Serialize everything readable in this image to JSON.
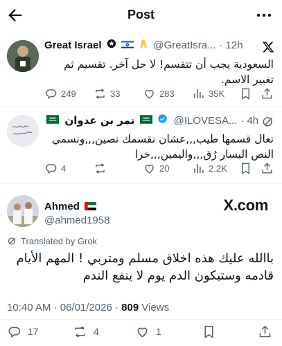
{
  "header": {
    "title": "Post"
  },
  "quote1": {
    "name": "Great Israel",
    "handle": "@GreatIsra...",
    "time": "12h",
    "text": "السعودية يجب أن تتقسم! لا حل آخر. تقسيم ثم تغيير الاسم.",
    "replies": "249",
    "reposts": "33",
    "likes": "283",
    "views": "35K",
    "flag_colors": [
      "#ffffff",
      "#0038b8"
    ],
    "ribbon_color": "#f5c842"
  },
  "quote2": {
    "name": "نمر بن عدوان",
    "handle": "@ILOVESA...",
    "time": "4h",
    "text": "تعال قسمها طيب,,,عشان نقسمك نصين,,,ونسمي النص اليسار رُق,,,واليمين,,,خرا",
    "replies": "4",
    "likes": "20",
    "views": "2.2K",
    "flag_color": "#006c35"
  },
  "main": {
    "name": "Ahmed",
    "handle": "@ahmed1958",
    "brand": "X.com",
    "translated": "Translated by Grok",
    "text": "باالله عليك هذه اخلاق مسلم ومتربي ! المهم الأيام قادمه وستبكون الدم يوم لا ينفع الندم",
    "time": "10:40 AM",
    "date": "06/01/2026",
    "views_count": "809",
    "views_label": "Views",
    "replies": "17",
    "reposts": "4",
    "likes": "1"
  },
  "colors": {
    "secondary": "#536471",
    "text": "#0f1419",
    "verified": "#1d9bf0",
    "divider": "#eff3f4"
  }
}
